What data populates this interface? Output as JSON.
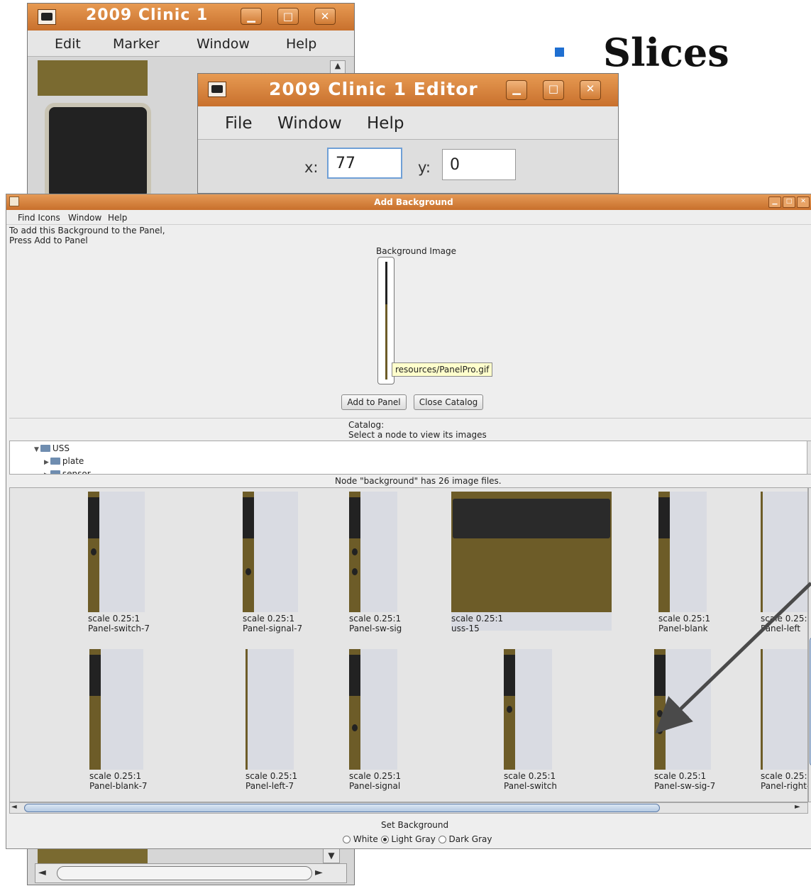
{
  "slide": {
    "title": "Slices"
  },
  "back_window": {
    "title": "2009 Clinic 1",
    "menu": [
      "Edit",
      "Marker",
      "Window",
      "Help"
    ]
  },
  "editor_window": {
    "title": "2009 Clinic 1 Editor",
    "menu": [
      "File",
      "Window",
      "Help"
    ],
    "x_label": "x:",
    "x_value": "77",
    "y_label": "y:",
    "y_value": "0"
  },
  "add_window": {
    "title": "Add Background",
    "menu": [
      "Find Icons",
      "Window",
      "Help"
    ],
    "instructions": [
      "To add this Background to the Panel,",
      "Press Add to Panel"
    ],
    "background_image_label": "Background Image",
    "tooltip": "resources/PanelPro.gif",
    "add_button": "Add to Panel",
    "close_button": "Close Catalog",
    "catalog_lines": [
      "Catalog:",
      "Select a node to view its images"
    ],
    "tree": [
      "USS",
      "plate",
      "sensor"
    ],
    "node_status": "Node \"background\" has 26 image files.",
    "tiles": [
      {
        "scale": "scale 0.25:1",
        "name": "Panel-switch-7"
      },
      {
        "scale": "scale 0.25:1",
        "name": "Panel-signal-7"
      },
      {
        "scale": "scale 0.25:1",
        "name": "Panel-sw-sig"
      },
      {
        "scale": "scale 0.25:1",
        "name": "uss-15"
      },
      {
        "scale": "scale 0.25:1",
        "name": "Panel-blank"
      },
      {
        "scale": "scale 0.25:",
        "name": "Panel-left"
      },
      {
        "scale": "scale 0.25:1",
        "name": "Panel-blank-7"
      },
      {
        "scale": "scale 0.25:1",
        "name": "Panel-left-7"
      },
      {
        "scale": "scale 0.25:1",
        "name": "Panel-signal"
      },
      {
        "scale": "scale 0.25:1",
        "name": "Panel-switch"
      },
      {
        "scale": "scale 0.25:1",
        "name": "Panel-sw-sig-7"
      },
      {
        "scale": "scale 0.25:",
        "name": "Panel-right-"
      }
    ],
    "set_background_label": "Set Background",
    "radio_options": [
      "White",
      "Light Gray",
      "Dark Gray"
    ],
    "radio_selected": "Light Gray"
  }
}
